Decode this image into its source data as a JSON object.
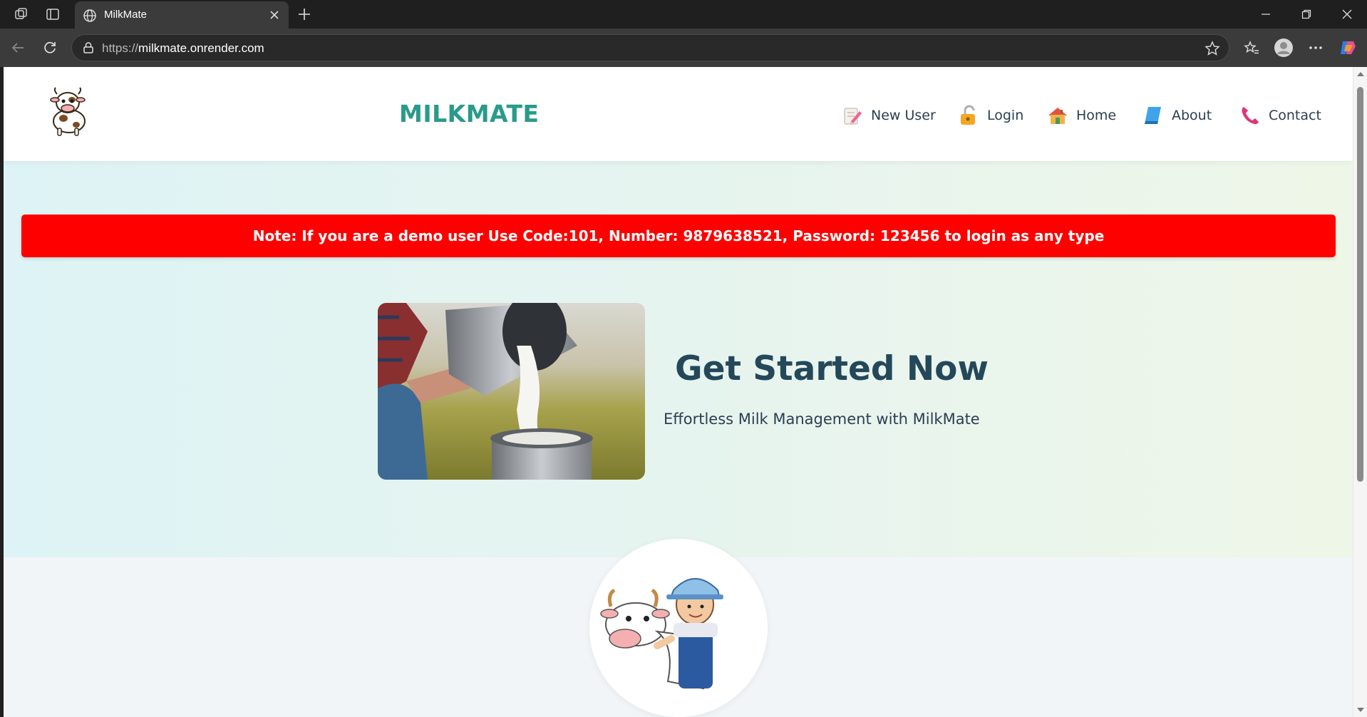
{
  "browser": {
    "tab_title": "MilkMate",
    "url_scheme": "https://",
    "url_host": "milkmate.onrender.com"
  },
  "header": {
    "brand": "MILKMATE",
    "nav": [
      {
        "label": "New User",
        "icon": "notepad-pencil-icon"
      },
      {
        "label": "Login",
        "icon": "padlock-icon"
      },
      {
        "label": "Home",
        "icon": "house-icon"
      },
      {
        "label": "About",
        "icon": "book-icon"
      },
      {
        "label": "Contact",
        "icon": "phone-icon"
      }
    ]
  },
  "hero": {
    "notice": "Note: If you are a demo user Use Code:101, Number: 9879638521, Password: 123456 to login as any type",
    "title": "Get Started Now",
    "subtitle": "Effortless Milk Management with MilkMate"
  },
  "colors": {
    "brand": "#2a9a8a",
    "notice_bg": "#ff0000",
    "title": "#24485a",
    "text": "#2c3e50"
  }
}
